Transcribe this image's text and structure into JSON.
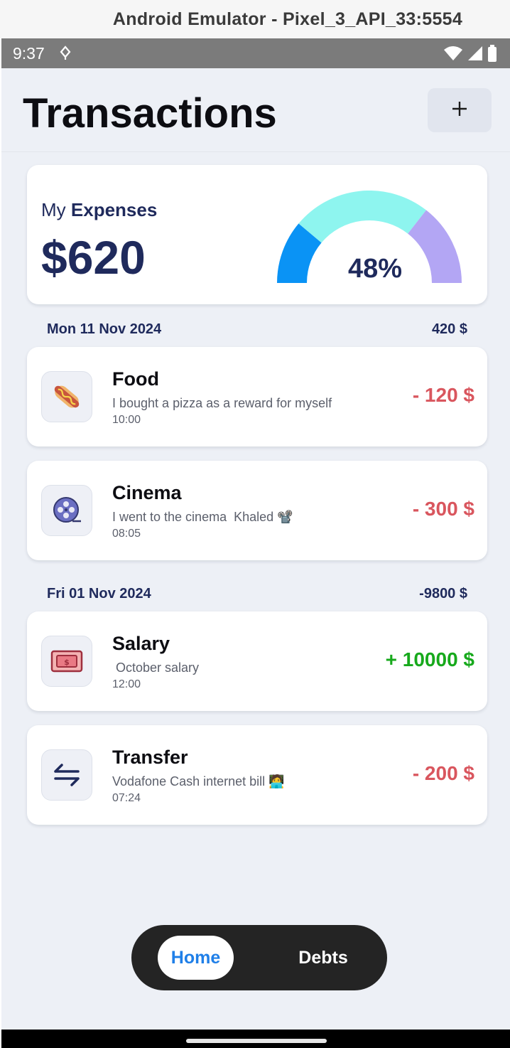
{
  "window": {
    "title": "Android Emulator - Pixel_3_API_33:5554"
  },
  "status_bar": {
    "time": "9:37",
    "icons": [
      "location-icon",
      "wifi-icon",
      "signal-icon",
      "battery-icon"
    ]
  },
  "header": {
    "title": "Transactions",
    "add_label": "+"
  },
  "summary": {
    "label_prefix": "My",
    "label_strong": "Expenses",
    "amount": "$620",
    "percent_text": "48%",
    "percent_value": 48,
    "gauge_colors": [
      "#0a93f5",
      "#8ef5ef",
      "#b3a6f4"
    ]
  },
  "groups": [
    {
      "date": "Mon 11 Nov 2024",
      "total": "420 $",
      "transactions": [
        {
          "icon": "hotdog-icon",
          "title": "Food",
          "description": "I bought a pizza as a reward for myself",
          "time": "10:00",
          "amount": "- 120 $",
          "type": "negative"
        },
        {
          "icon": "film-reel-icon",
          "title": "Cinema",
          "description": "I went to the cinema  Khaled 📽️",
          "time": "08:05",
          "amount": "- 300 $",
          "type": "negative"
        }
      ]
    },
    {
      "date": "Fri 01 Nov 2024",
      "total": "-9800 $",
      "transactions": [
        {
          "icon": "money-ticket-icon",
          "title": "Salary",
          "description": " October salary",
          "time": "12:00",
          "amount": "+ 10000 $",
          "type": "positive"
        },
        {
          "icon": "transfer-arrows-icon",
          "title": "Transfer",
          "description": "Vodafone Cash internet bill 🧑‍💻",
          "time": "07:24",
          "amount": "- 200 $",
          "type": "negative"
        }
      ]
    }
  ],
  "bottom_nav": {
    "home_label": "Home",
    "debts_label": "Debts",
    "active": "Home"
  },
  "colors": {
    "accent": "#1f7fe8",
    "negative": "#d9565e",
    "positive": "#17a91c",
    "navy": "#1f2a5c"
  }
}
